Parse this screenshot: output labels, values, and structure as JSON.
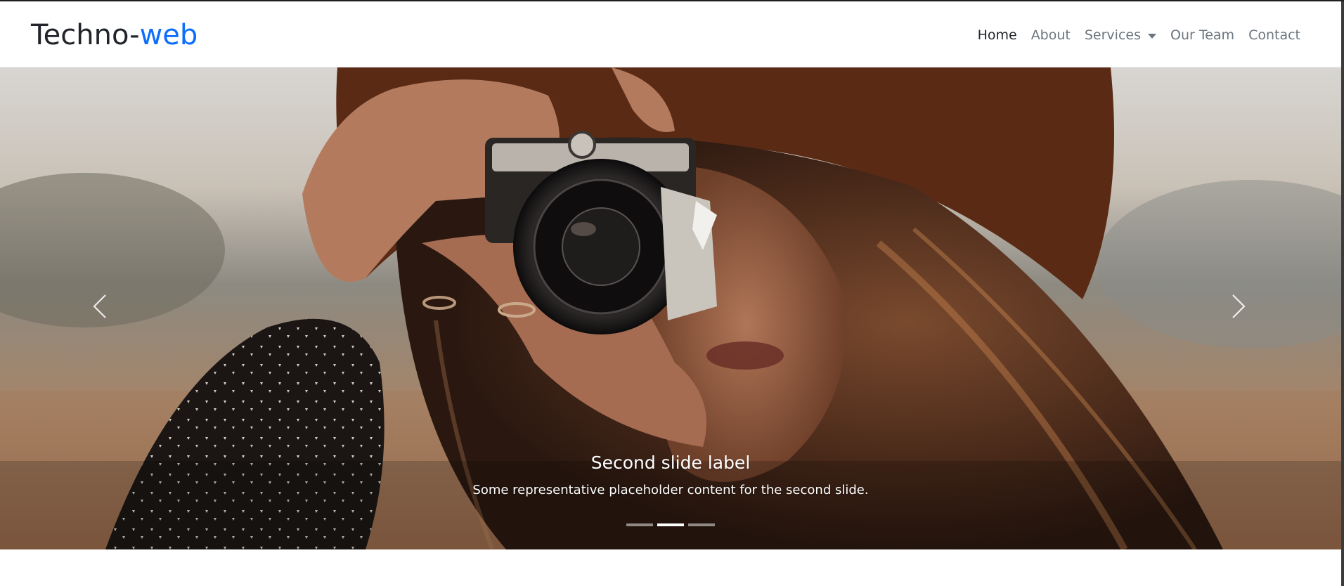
{
  "brand": {
    "text_main": "Techno-",
    "text_accent": "web"
  },
  "nav": {
    "items": [
      {
        "label": "Home",
        "active": true
      },
      {
        "label": "About",
        "active": false
      },
      {
        "label": "Services",
        "active": false,
        "dropdown": true
      },
      {
        "label": "Our Team",
        "active": false
      },
      {
        "label": "Contact",
        "active": false
      }
    ]
  },
  "carousel": {
    "caption_title": "Second slide label",
    "caption_text": "Some representative placeholder content for the second slide.",
    "indicator_count": 3,
    "active_index": 1,
    "prev_icon": "chevron-left-icon",
    "next_icon": "chevron-right-icon"
  },
  "colors": {
    "accent": "#0d6efd",
    "text_dark": "#212529",
    "nav_muted": "#6c757d"
  }
}
